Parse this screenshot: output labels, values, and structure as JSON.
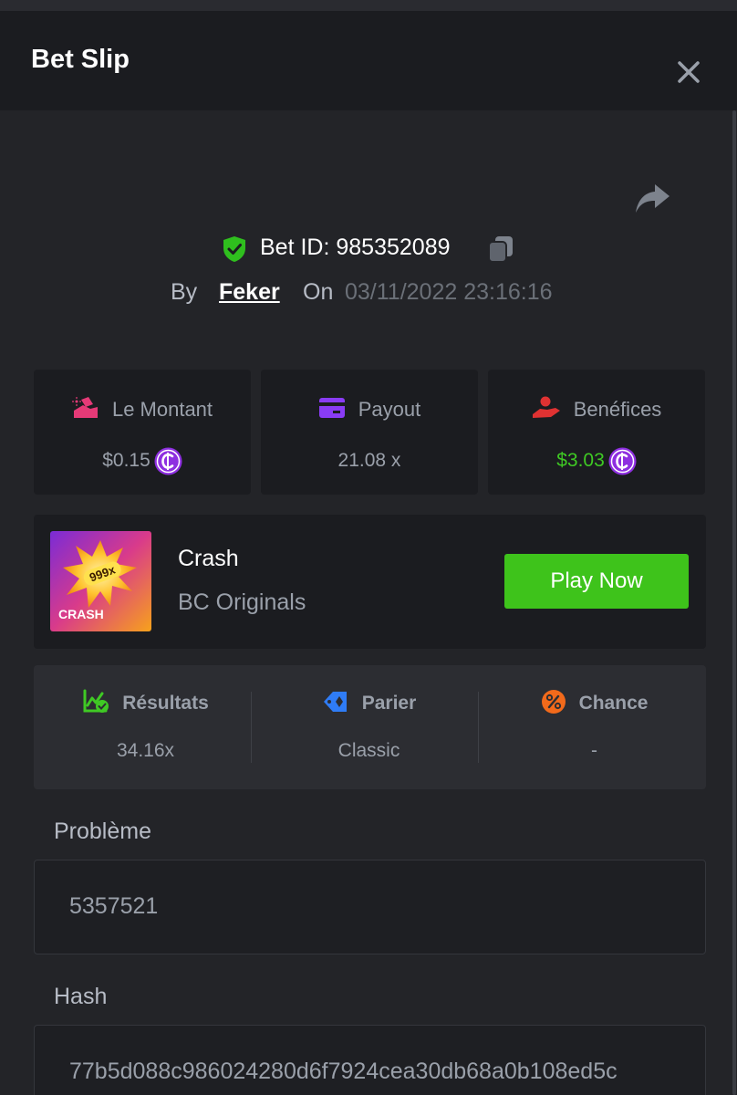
{
  "header": {
    "title": "Bet Slip"
  },
  "bet": {
    "id_label": "Bet ID: 985352089",
    "by_label": "By",
    "user": "Feker",
    "on_label": "On",
    "datetime": "03/11/2022 23:16:16"
  },
  "stats": [
    {
      "label": "Le Montant",
      "value": "$0.15",
      "icon": "coins-hand-icon",
      "color": "#e53a77",
      "has_coin": true
    },
    {
      "label": "Payout",
      "value": "21.08 x",
      "icon": "card-icon",
      "color": "#8a3cf5",
      "has_coin": false
    },
    {
      "label": "Benéfices",
      "value": "$3.03",
      "icon": "profit-hand-icon",
      "color": "#e03232",
      "value_color": "#3fc924",
      "has_coin": true
    }
  ],
  "game": {
    "name": "Crash",
    "provider": "BC Originals",
    "thumb_badge": "999x",
    "thumb_title": "CRASH",
    "play_label": "Play Now"
  },
  "results": [
    {
      "label": "Résultats",
      "value": "34.16x",
      "icon": "chart-check-icon",
      "color": "#3fc924"
    },
    {
      "label": "Parier",
      "value": "Classic",
      "icon": "tag-icon",
      "color": "#2f7cf6"
    },
    {
      "label": "Chance",
      "value": "-",
      "icon": "percent-icon",
      "color": "#f26a1b"
    }
  ],
  "fields": {
    "probleme_label": "Problème",
    "probleme_value": "5357521",
    "hash_label": "Hash",
    "hash_value": "77b5d088c986024280d6f7924cea30db68a0b108ed5c"
  },
  "colors": {
    "accent_green": "#3ec31b",
    "coin_purple": "#8e2fe0",
    "shield_green": "#2fbf1e"
  }
}
